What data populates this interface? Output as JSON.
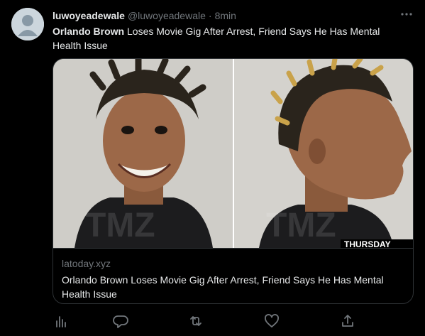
{
  "tweet": {
    "display_name": "luwoyeadewale",
    "handle": "@luwoyeadewale",
    "separator": "·",
    "time": "8min",
    "more_icon": "ellipsis-icon",
    "text_bold": "Orlando Brown",
    "text_rest": " Loses Movie Gig After Arrest, Friend Says He Has Mental Health Issue"
  },
  "card": {
    "image_caption": "THURSDAY",
    "watermark": "TMZ",
    "domain": "latoday.xyz",
    "title": "Orlando Brown Loses Movie Gig After Arrest, Friend Says He Has Mental Health Issue"
  },
  "actions": [
    {
      "icon": "analytics-icon"
    },
    {
      "icon": "reply-icon"
    },
    {
      "icon": "retweet-icon"
    },
    {
      "icon": "like-icon"
    },
    {
      "icon": "share-icon"
    }
  ],
  "colors": {
    "background": "#000000",
    "text": "#e7e9ea",
    "muted": "#71767b",
    "border": "#2f3336"
  }
}
